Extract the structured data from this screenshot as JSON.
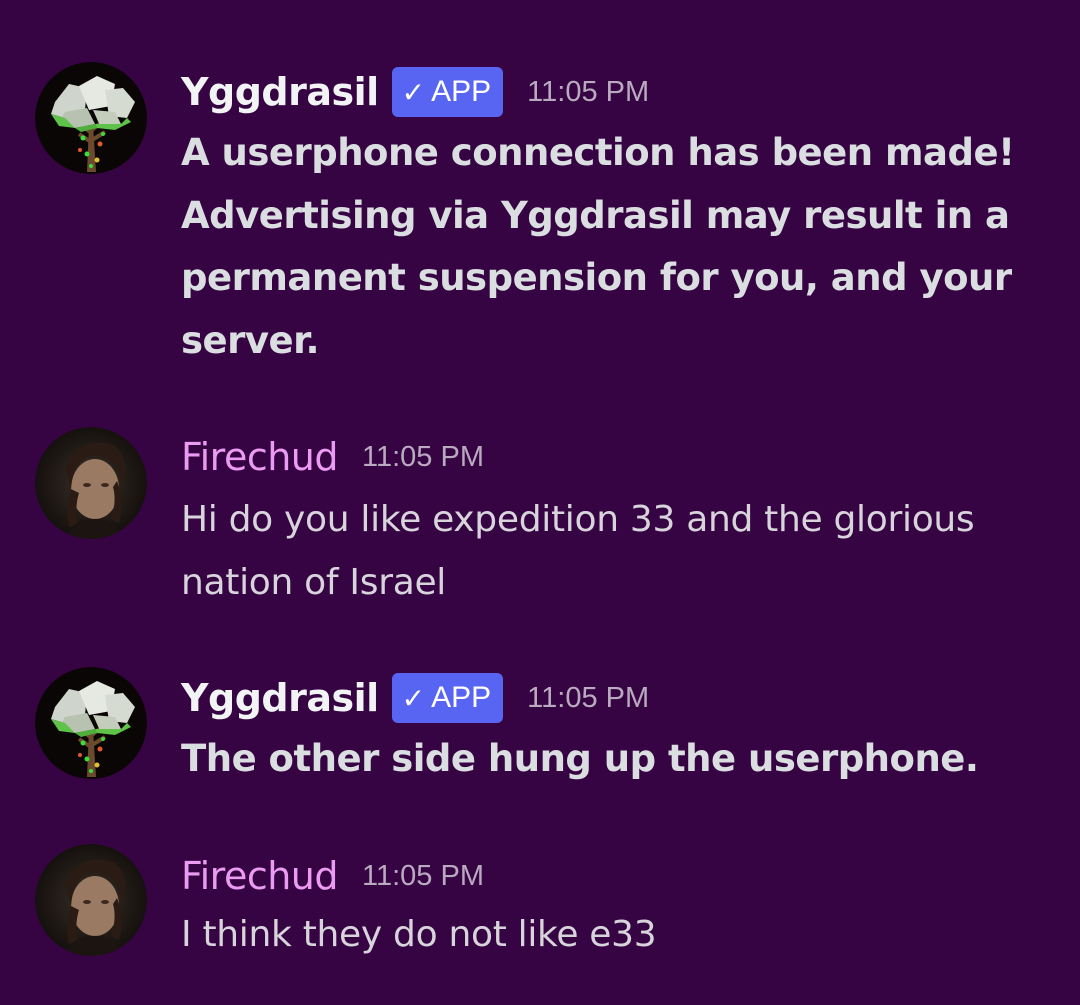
{
  "messages": [
    {
      "author": "Yggdrasil",
      "badge": "APP",
      "badge_icon": "checkmark-icon",
      "time": "11:05 PM",
      "text": "A userphone connection has been made! Advertising via Yggdrasil may result in a permanent suspension for you, and your server."
    },
    {
      "author": "Firechud",
      "time": "11:05 PM",
      "text": "Hi do you like expedition 33 and the glorious nation of Israel"
    },
    {
      "author": "Yggdrasil",
      "badge": "APP",
      "badge_icon": "checkmark-icon",
      "time": "11:05 PM",
      "text": "The other side hung up the userphone."
    },
    {
      "author": "Firechud",
      "time": "11:05 PM",
      "text": "I think they do not like e33"
    }
  ],
  "colors": {
    "background": "#360442",
    "bot_name": "#f2f3f5",
    "human_name": "#ec9bf2",
    "badge": "#5865f2",
    "timestamp": "#b9aac0",
    "message_text": "#dbdee1"
  }
}
